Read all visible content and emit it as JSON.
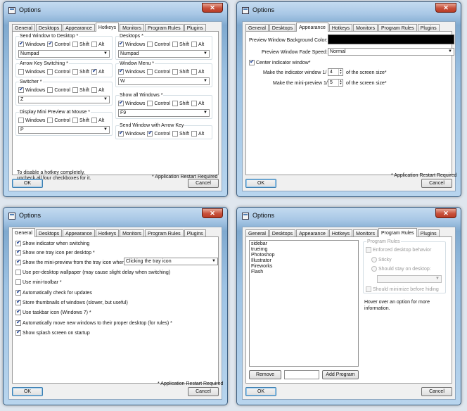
{
  "windows": {
    "hotkeys": {
      "title": "Options",
      "tabs": [
        "General",
        "Desktops",
        "Appearance",
        "Hotkeys",
        "Monitors",
        "Program Rules",
        "Plugins"
      ],
      "groups": [
        {
          "title": "Send Window to Desktop *",
          "windows": true,
          "control": true,
          "shift": false,
          "alt": false,
          "key": "Numpad"
        },
        {
          "title": "Arrow Key Switching *",
          "windows": false,
          "control": false,
          "shift": false,
          "alt": true,
          "key": ""
        },
        {
          "title": "Switcher *",
          "windows": true,
          "control": false,
          "shift": false,
          "alt": false,
          "key": "Z"
        },
        {
          "title": "Display Mini Preview at Mouse *",
          "windows": false,
          "control": false,
          "shift": false,
          "alt": false,
          "key": "P"
        },
        {
          "title": "Desktops *",
          "windows": true,
          "control": false,
          "shift": false,
          "alt": false,
          "key": "Numpad"
        },
        {
          "title": "Window Menu *",
          "windows": true,
          "control": false,
          "shift": false,
          "alt": false,
          "key": "W"
        },
        {
          "title": "Show all Windows *",
          "windows": true,
          "control": false,
          "shift": false,
          "alt": false,
          "key": "F9"
        },
        {
          "title": "Send Window with Arrow Key",
          "windows": true,
          "control": true,
          "shift": false,
          "alt": false,
          "key": ""
        }
      ],
      "mod_labels": {
        "windows": "Windows",
        "control": "Control",
        "shift": "Shift",
        "alt": "Alt"
      },
      "hint_line1": "To disable a hotkey completely,",
      "hint_line2": "uncheck all four checkboxes for it.",
      "restart_note": "* Application Restart Required",
      "ok": "OK",
      "cancel": "Cancel"
    },
    "appearance": {
      "title": "Options",
      "tabs": [
        "General",
        "Desktops",
        "Appearance",
        "Hotkeys",
        "Monitors",
        "Program Rules",
        "Plugins"
      ],
      "bg_color_label": "Preview Window Background Color:",
      "bg_color": "#000000",
      "fade_label": "Preview Window Fade Speed:",
      "fade_value": "Normal",
      "center_label": "Center indicator window*",
      "center_checked": true,
      "indicator_label": "Make the indicator window 1/",
      "indicator_value": "4",
      "indicator_suffix": "of the screen size*",
      "mini_label": "Make the mini-preview 1/",
      "mini_value": "5",
      "mini_suffix": "of the screen size*",
      "restart_note": "* Application Restart Required",
      "ok": "OK",
      "cancel": "Cancel"
    },
    "general": {
      "title": "Options",
      "tabs": [
        "General",
        "Desktops",
        "Appearance",
        "Hotkeys",
        "Monitors",
        "Program Rules",
        "Plugins"
      ],
      "options": [
        {
          "label": "Show indicator when switching",
          "checked": true
        },
        {
          "label": "Show one tray icon per desktop *",
          "checked": true
        },
        {
          "label": "Show the mini-preview from the tray icon when:",
          "checked": true
        },
        {
          "label": "Use per-desktop wallpaper (may cause slight delay when switching)",
          "checked": false
        },
        {
          "label": "Use mini-toolbar *",
          "checked": false
        },
        {
          "label": "Automatically check for updates",
          "checked": true
        },
        {
          "label": "Store thumbnails of windows (slower, but useful)",
          "checked": true
        },
        {
          "label": "Use taskbar icon (Windows 7) *",
          "checked": true
        },
        {
          "label": "Automatically move new windows to their proper desktop (for rules) *",
          "checked": true
        },
        {
          "label": "Show splash screen on startup",
          "checked": true
        }
      ],
      "tray_select": "Clicking the tray icon",
      "restart_note": "* Application Restart Required",
      "ok": "OK",
      "cancel": "Cancel"
    },
    "program_rules": {
      "title": "Options",
      "tabs": [
        "General",
        "Desktops",
        "Appearance",
        "Hotkeys",
        "Monitors",
        "Program Rules",
        "Plugins"
      ],
      "programs": [
        "sidebar",
        "trueimg",
        "Photoshop",
        "Illustrator",
        "Fireworks",
        "Flash"
      ],
      "rules_group": "Program Rules",
      "enforced_label": "Enforced desktop behavior",
      "sticky_label": "Sticky",
      "stay_label": "Should stay on desktop:",
      "minimize_label": "Should minimize before hiding",
      "hint": "Hover over an option for more information.",
      "remove": "Remove",
      "add": "Add Program",
      "ok": "OK",
      "cancel": "Cancel"
    }
  }
}
